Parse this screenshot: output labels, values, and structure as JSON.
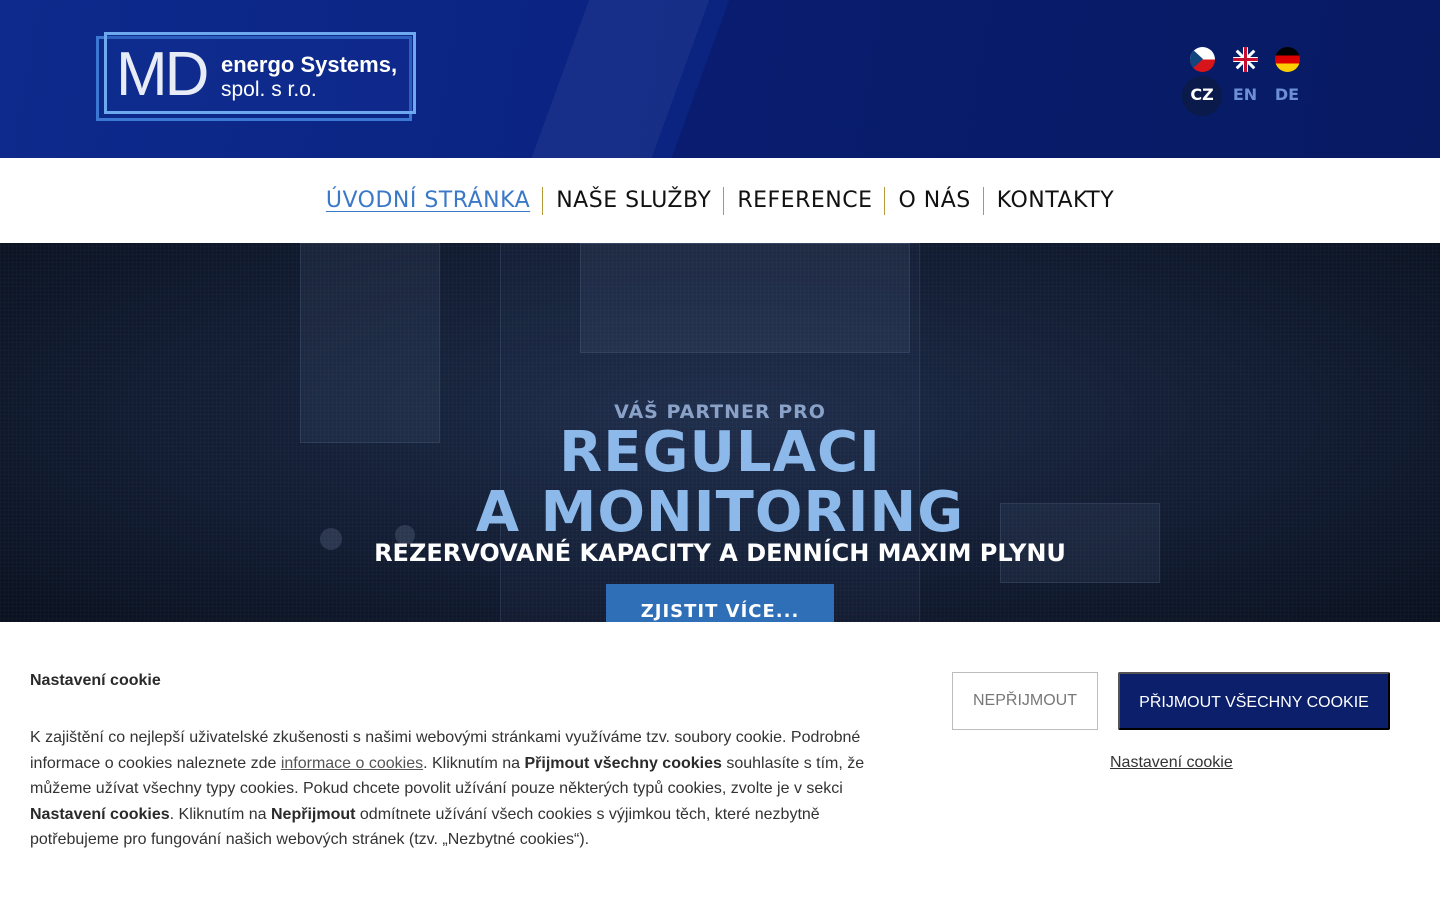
{
  "header": {
    "logo": {
      "mark": "MD",
      "line1": "energo Systems,",
      "line2": "spol. s r.o."
    },
    "languages": [
      {
        "code": "CZ",
        "flag": "czech-flag-icon",
        "active": true
      },
      {
        "code": "EN",
        "flag": "uk-flag-icon",
        "active": false
      },
      {
        "code": "DE",
        "flag": "german-flag-icon",
        "active": false
      }
    ]
  },
  "nav": {
    "items": [
      {
        "label": "ÚVODNÍ STRÁNKA",
        "active": true
      },
      {
        "label": "NAŠE SLUŽBY",
        "active": false
      },
      {
        "label": "REFERENCE",
        "active": false
      },
      {
        "label": "O NÁS",
        "active": false
      },
      {
        "label": "KONTAKTY",
        "active": false
      }
    ]
  },
  "hero": {
    "subtitle": "VÁŠ PARTNER PRO",
    "headline_line1": "REGULACI",
    "headline_line2": "A MONITORING",
    "caption": "REZERVOVANÉ KAPACITY A DENNÍCH MAXIM PLYNU",
    "cta_label": "ZJISTIT VÍCE..."
  },
  "cookie_bar": {
    "title": "Nastavení cookie",
    "text": {
      "part1": "K zajištění co nejlepší uživatelské zkušenosti s našimi webovými stránkami využíváme tzv. soubory cookie. Podrobné informace o cookies naleznete zde ",
      "link": "informace o cookies",
      "part2": ". Kliknutím na ",
      "bold1": "Přijmout všechny cookies",
      "part3": " souhlasíte s tím, že můžeme užívat všechny typy cookies. Pokud chcete povolit užívání pouze některých typů cookies, zvolte je v sekci ",
      "bold2": "Nastavení cookies",
      "part4": ". Kliknutím na ",
      "bold3": "Nepřijmout",
      "part5": " odmítnete užívání všech cookies s výjimkou těch, které nezbytně potřebujeme pro fungování našich webových stránek (tzv. „Nezbytné cookies“)."
    },
    "reject_label": "NEPŘIJMOUT",
    "accept_label": "PŘIJMOUT VŠECHNY COOKIE",
    "settings_label": "Nastavení cookie"
  },
  "colors": {
    "header_bg": "#0d2a8c",
    "accept_button": "#0b1f6b",
    "cta_button": "#2f6fb8",
    "nav_active": "#3a78c8",
    "hero_headline": "#8db9ea"
  }
}
